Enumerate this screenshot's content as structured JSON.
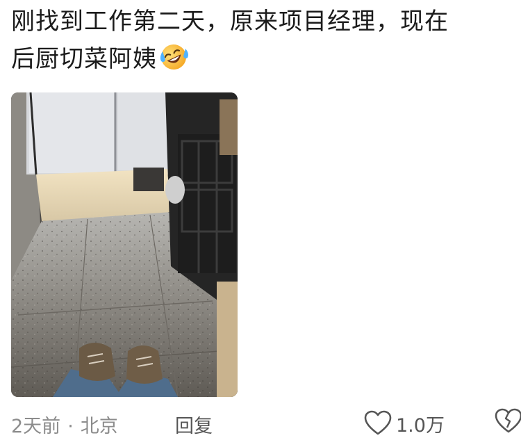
{
  "post": {
    "text_line1": "刚找到工作第二天，原来项目经理，现在",
    "text_line2": "后厨切菜阿姨",
    "emoji": "laughing-crying-emoji"
  },
  "meta": {
    "time": "2天前",
    "separator": "·",
    "location": "北京",
    "reply_label": "回复",
    "like_count": "1.0万"
  },
  "icons": {
    "like": "heart-outline-icon",
    "dislike": "broken-heart-icon"
  },
  "colors": {
    "text": "#1b1b1b",
    "meta": "#8c8c8c",
    "action": "#555555"
  }
}
